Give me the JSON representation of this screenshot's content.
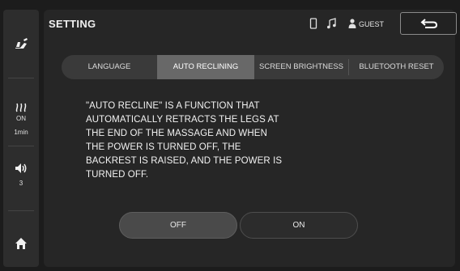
{
  "header": {
    "title": "SETTING",
    "user_label": "GUEST"
  },
  "sidebar": {
    "heat_status": "ON",
    "heat_timer": "1min",
    "volume_level": "3"
  },
  "tabs": [
    {
      "label": "LANGUAGE",
      "active": false
    },
    {
      "label": "AUTO RECLINING",
      "active": true
    },
    {
      "label": "SCREEN BRIGHTNESS",
      "active": false
    },
    {
      "label": "BLUETOOTH RESET",
      "active": false
    }
  ],
  "description": {
    "lines": [
      "\"AUTO RECLINE\" IS A FUNCTION THAT",
      "AUTOMATICALLY RETRACTS THE LEGS AT",
      "THE END OF THE MASSAGE AND WHEN",
      "THE POWER IS TURNED OFF, THE",
      "BACKREST IS RAISED, AND THE POWER IS",
      "TURNED OFF."
    ]
  },
  "toggle": {
    "off_label": "OFF",
    "on_label": "ON",
    "selected": "OFF"
  },
  "icons": {
    "chair": "recline-chair-icon",
    "heat": "heat-icon",
    "volume": "speaker-icon",
    "home": "home-icon",
    "phone": "phone-icon",
    "music": "music-note-icon",
    "user": "user-icon",
    "back": "back-arrow-icon"
  },
  "colors": {
    "active_tab": "#686868",
    "panel": "#262626",
    "background": "#1c1c1c"
  }
}
